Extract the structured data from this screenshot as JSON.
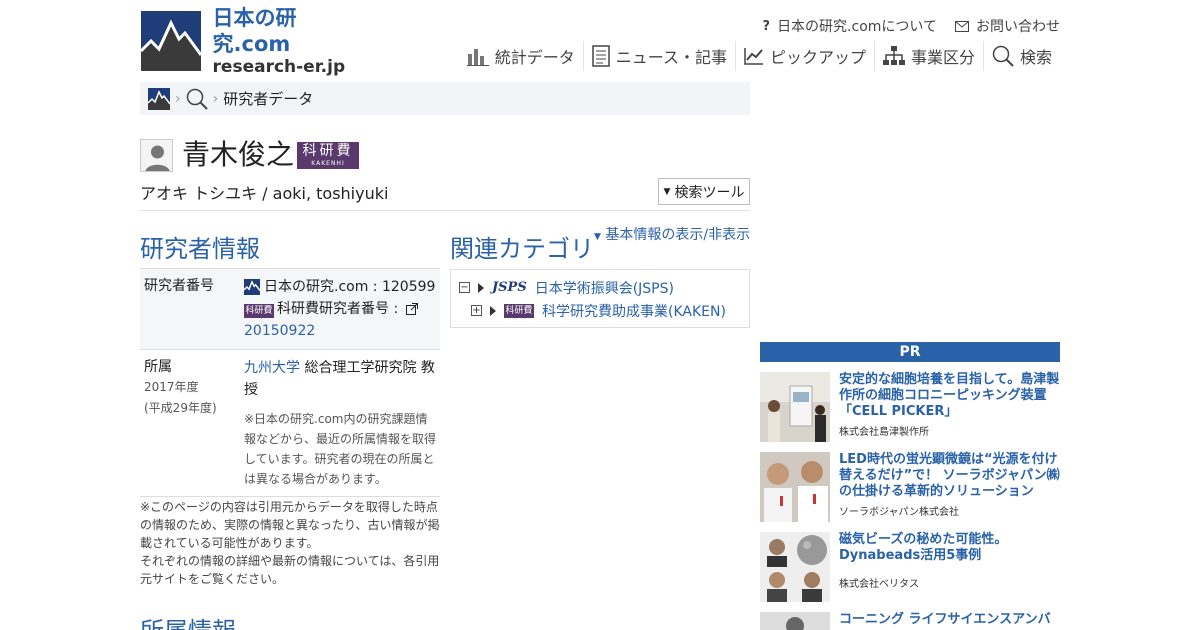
{
  "site": {
    "title": "日本の研究.com",
    "subtitle": "research-er.jp"
  },
  "topnav": {
    "about": "日本の研究.comについて",
    "contact": "お問い合わせ"
  },
  "mainnav": [
    {
      "label": "統計データ",
      "icon": "bar-chart-icon"
    },
    {
      "label": "ニュース・記事",
      "icon": "document-icon"
    },
    {
      "label": "ピックアップ",
      "icon": "line-chart-icon"
    },
    {
      "label": "事業区分",
      "icon": "sitemap-icon"
    },
    {
      "label": "検索",
      "icon": "search-icon"
    }
  ],
  "breadcrumb": {
    "current": "研究者データ"
  },
  "researcher": {
    "name": "青木俊之",
    "reading": "アオキ トシユキ / aoki, toshiyuki",
    "badge_main": "科研費",
    "badge_sub": "KAKENHI"
  },
  "tools_button": "検索ツール",
  "researcher_info": {
    "title": "研究者情報",
    "number_label": "研究者番号",
    "site_number": "日本の研究.com : 120599",
    "kaken_number_label": "科研費研究者番号 :",
    "kaken_number": "20150922",
    "affiliation_label": "所属",
    "affiliation_year": "2017年度",
    "affiliation_era": "(平成29年度)",
    "university": "九州大学",
    "department": "総合理工学研究院 教授",
    "affiliation_note": "※日本の研究.com内の研究課題情報などから、最近の所属情報を取得しています。研究者の現在の所属とは異なる場合があります。"
  },
  "disclaimer": {
    "line1": "※このページの内容は引用元からデータを取得した時点の情報のため、実際の情報と異なったり、古い情報が掲載されている可能性があります。",
    "line2": "それぞれの情報の詳細や最新の情報については、各引用元サイトをご覧ください。"
  },
  "affiliation_section_title": "所属情報",
  "related": {
    "title": "関連カテゴリ",
    "toggle": "基本情報の表示/非表示",
    "items": [
      {
        "badge": "JSPS",
        "label": "日本学術振興会(JSPS)",
        "expanded": true
      },
      {
        "badge": "科研費",
        "label": "科学研究費助成事業(KAKEN)",
        "expanded": false
      }
    ]
  },
  "pr": {
    "header": "PR",
    "items": [
      {
        "title": "安定的な細胞培養を目指して。島津製作所の細胞コロニーピッキング装置「CELL PICKER」",
        "company": "株式会社島津製作所"
      },
      {
        "title": "LED時代の蛍光顕微鏡は“光源を付け替えるだけ”で！ ソーラボジャパン㈱の仕掛ける革新的ソリューション",
        "company": "ソーラボジャパン株式会社"
      },
      {
        "title": "磁気ビーズの秘めた可能性。Dynabeads活用5事例",
        "company": "株式会社ベリタス"
      },
      {
        "title": "コーニング ライフサイエンスアンバ",
        "company": ""
      }
    ]
  },
  "colors": {
    "link": "#2a62a8",
    "brand_navy": "#1f3d78",
    "kaken_purple": "#5a3a6e"
  }
}
